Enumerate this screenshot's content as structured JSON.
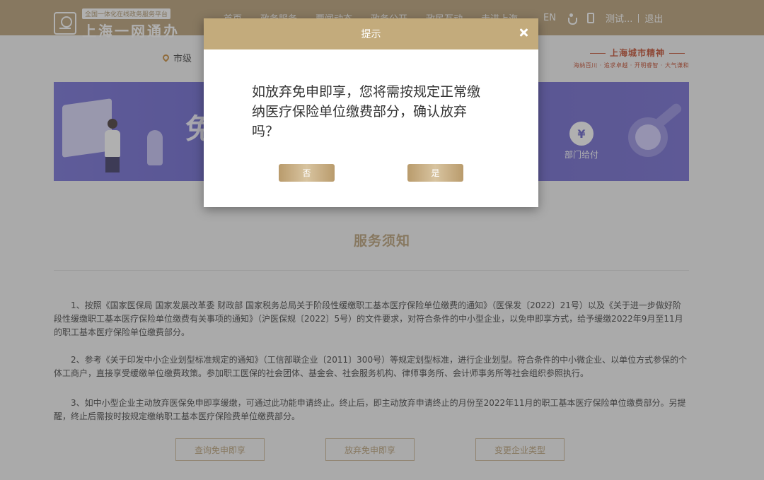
{
  "header": {
    "logo_badge": "全国一体化在线政务服务平台",
    "logo_name": "上海一网通办",
    "nav": [
      "首页",
      "政务服务",
      "要闻动态",
      "政务公开",
      "政民互动",
      "走进上海"
    ],
    "lang": "EN",
    "user": "测试...",
    "logout": "退出"
  },
  "subheader": {
    "location": "市级",
    "city_spirit_title": "上海城市精神",
    "city_spirit_sub": "海纳百川 · 追求卓越 · 开明睿智 · 大气谦和"
  },
  "banner": {
    "big_text": "免",
    "service_label": "部门给付",
    "coin_symbol": "¥"
  },
  "notice": {
    "title": "服务须知",
    "p1": "1、按照《国家医保局 国家发展改革委 财政部 国家税务总局关于阶段性缓缴职工基本医疗保险单位缴费的通知》（医保发〔2022〕21号）以及《关于进一步做好阶段性缓缴职工基本医疗保险单位缴费有关事项的通知》（沪医保规〔2022〕5号）的文件要求，对符合条件的中小型企业，以免申即享方式，给予缓缴2022年9月至11月的职工基本医疗保险单位缴费部分。",
    "p2": "2、参考《关于印发中小企业划型标准规定的通知》（工信部联企业〔2011〕300号）等规定划型标准，进行企业划型。符合条件的中小微企业、以单位方式参保的个体工商户，直接享受缓缴单位缴费政策。参加职工医保的社会团体、基金会、社会服务机构、律师事务所、会计师事务所等社会组织参照执行。",
    "p3": "3、如中小型企业主动放弃医保免申即享缓缴，可通过此功能申请终止。终止后，即主动放弃申请终止的月份至2022年11月的职工基本医疗保险单位缴费部分。另提醒，终止后需按时按规定缴纳职工基本医疗保险费单位缴费部分。",
    "actions": [
      "查询免申即享",
      "放弃免申即享",
      "变更企业类型"
    ]
  },
  "dialog": {
    "title": "提示",
    "message": "如放弃免申即享，您将需按规定正常缴纳医疗保险单位缴费部分，确认放弃吗？",
    "no_label": "否",
    "yes_label": "是"
  },
  "colors": {
    "brand": "#b59a6e",
    "dialog_header": "#c3ab7c",
    "banner": "#5b56c7"
  }
}
